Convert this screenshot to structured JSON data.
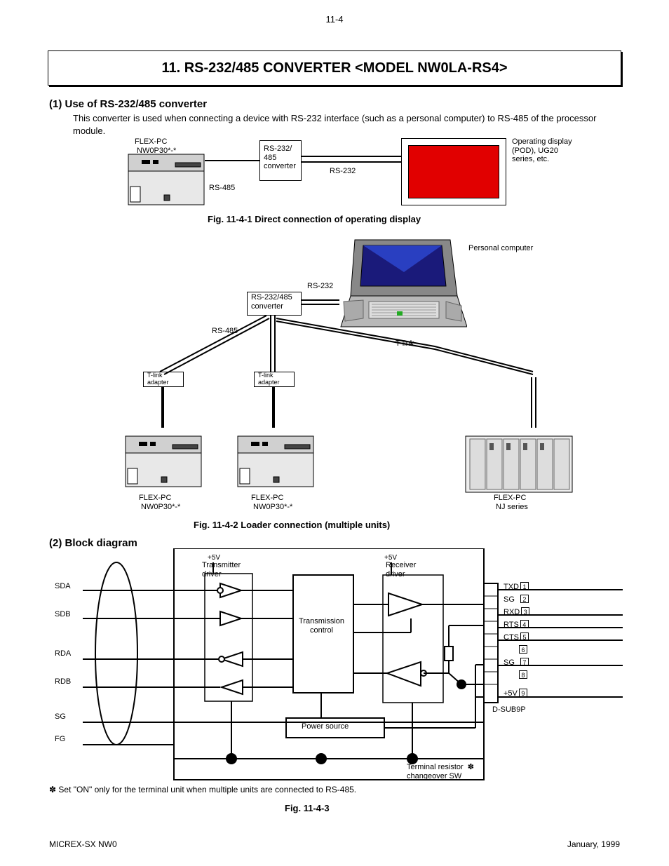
{
  "page_number": "11-4",
  "title": "11.  RS-232/485 CONVERTER  <MODEL  NW0LA-RS4>",
  "sec1_head": "(1)  Use  of  RS-232/485  converter",
  "sec1_p1": "This converter is used when connecting a device with RS-232 interface (such as a personal computer) to RS-485 of the processor module.",
  "fig1_caption": "Fig. 11-4-1  Direct connection of operating display",
  "labels": {
    "plc1": "FLEX-PC\n NW0P30*-*",
    "conv1": "RS-232/\n485\nconverter",
    "display": "Operating display\n(POD), UG20\nseries, etc.",
    "rs232_a": "RS-232",
    "rs232_b": "RS-232",
    "conv2": "RS-232/485\nconverter",
    "pc": "Personal computer",
    "rs485_a": "RS-485",
    "rs485_b": "RS-485",
    "plc2": "FLEX-PC\n NW0P30*-*",
    "plc3": "FLEX-PC\n NW0P30*-*",
    "plc4": "FLEX-PC\n NJ series",
    "t_link": "T-link\nadapter",
    "t_link_lbl": "T-link",
    "t_link_a": "T-link\nadapter",
    "t_link_b": "T-link\nadapter",
    "fig2_caption": "Fig. 11-4-2  Loader connection (multiple units)",
    "blockdiag": "(2)  Block  diagram",
    "sda": "SDA",
    "sdb": "SDB",
    "rda": "RDA",
    "rdb": "RDB",
    "sg": "SG",
    "fg": "FG",
    "tx_driver": "Transmitter\ndriver",
    "rcv_driver": "Receiver\ndriver",
    "tx_ctrl": "Transmission\ncontrol",
    "power": "Power source",
    "p1": "TXD1",
    "p2": "SG2",
    "p3": "RXD3",
    "p4": "RTS4",
    "p5": "CTS5",
    "p6": "6",
    "p7": "SG7",
    "p8": "8",
    "p9": "+5V9",
    "p5v": "+5V",
    "p5v2": "+5V",
    "dsub": "D-SUB9P",
    "sw_note": "Terminal resistor  ✽\nchangeover SW",
    "footnote": "✽ Set \"ON\" only for the terminal unit when multiple units are connected to RS-485.",
    "figcaption3": "Fig. 11-4-3",
    "footer_left": "MICREX-SX NW0",
    "footer_right": "January, 1999"
  }
}
